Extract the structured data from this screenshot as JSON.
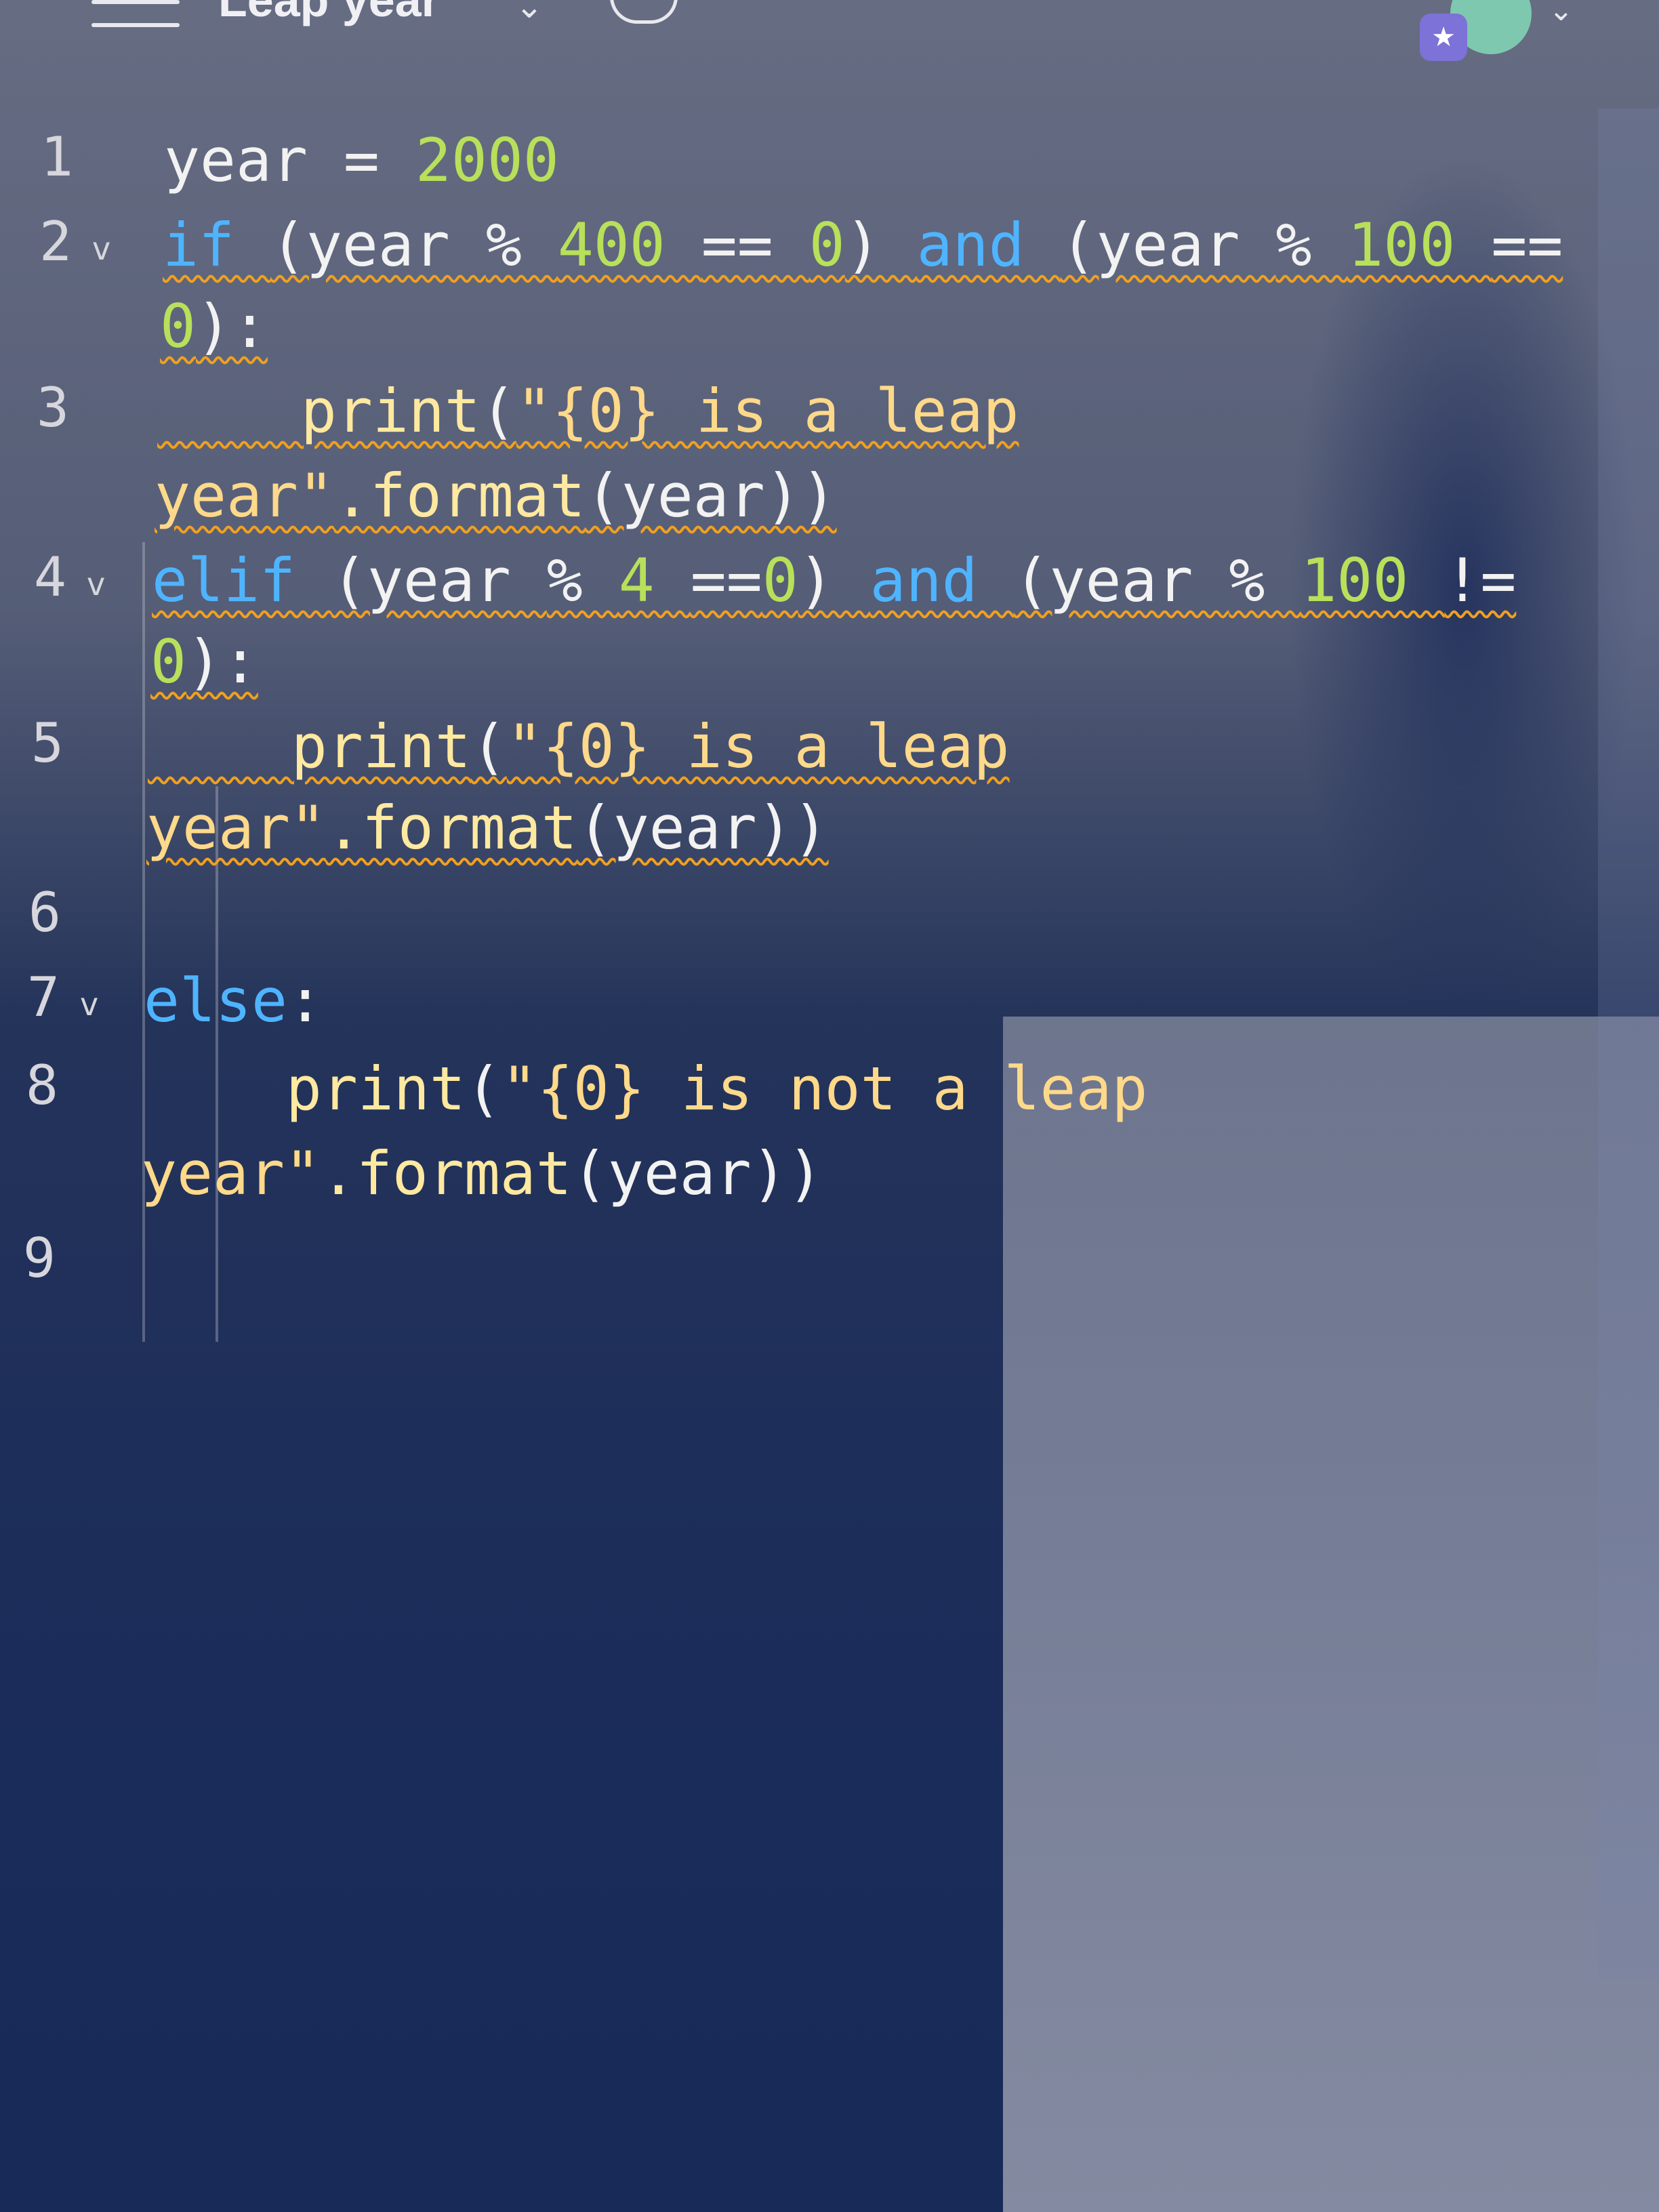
{
  "header": {
    "title": "Leap year",
    "menu_icon": "hamburger-menu-icon",
    "title_dropdown_icon": "chevron-down-icon",
    "cloud_icon": "cloud-sync-icon",
    "account_icon": "avatar",
    "account_dropdown_icon": "chevron-down-icon",
    "badge_icon": "star-icon",
    "badge_glyph": "★"
  },
  "editor": {
    "fold_glyph": "v",
    "lines": [
      {
        "number": "1",
        "segments": [
          {
            "cls": "var",
            "text": "year "
          },
          {
            "cls": "op",
            "text": "= "
          },
          {
            "cls": "num",
            "text": "2000"
          }
        ]
      },
      {
        "number": "2",
        "fold": true,
        "squiggle": true,
        "segments": [
          {
            "cls": "kw",
            "text": "if "
          },
          {
            "cls": "var",
            "text": "(year "
          },
          {
            "cls": "op",
            "text": "% "
          },
          {
            "cls": "num",
            "text": "400 "
          },
          {
            "cls": "op",
            "text": "== "
          },
          {
            "cls": "num",
            "text": "0"
          },
          {
            "cls": "var",
            "text": ") "
          },
          {
            "cls": "kw",
            "text": "and "
          },
          {
            "cls": "var",
            "text": "(year "
          },
          {
            "cls": "op",
            "text": "% "
          },
          {
            "cls": "num",
            "text": "100 "
          },
          {
            "cls": "op",
            "text": "=="
          }
        ]
      },
      {
        "number": "",
        "squiggle": true,
        "segments": [
          {
            "cls": "num",
            "text": "0"
          },
          {
            "cls": "var",
            "text": "):"
          }
        ]
      },
      {
        "number": "3",
        "squiggle": true,
        "segments": [
          {
            "cls": "fn",
            "text": "    print"
          },
          {
            "cls": "var",
            "text": "("
          },
          {
            "cls": "str",
            "text": "\"{0} is a leap"
          }
        ]
      },
      {
        "number": "",
        "squiggle": true,
        "segments": [
          {
            "cls": "str",
            "text": "year\""
          },
          {
            "cls": "fn",
            "text": ".format"
          },
          {
            "cls": "var",
            "text": "(year))"
          }
        ]
      },
      {
        "number": "4",
        "fold": true,
        "squiggle": true,
        "segments": [
          {
            "cls": "kw",
            "text": "elif "
          },
          {
            "cls": "var",
            "text": "(year "
          },
          {
            "cls": "op",
            "text": "% "
          },
          {
            "cls": "num",
            "text": "4 "
          },
          {
            "cls": "op",
            "text": "=="
          },
          {
            "cls": "num",
            "text": "0"
          },
          {
            "cls": "var",
            "text": ") "
          },
          {
            "cls": "kw",
            "text": "and "
          },
          {
            "cls": "var",
            "text": "(year "
          },
          {
            "cls": "op",
            "text": "% "
          },
          {
            "cls": "num",
            "text": "100 "
          },
          {
            "cls": "op",
            "text": "!="
          }
        ]
      },
      {
        "number": "",
        "squiggle": true,
        "segments": [
          {
            "cls": "num",
            "text": "0"
          },
          {
            "cls": "var",
            "text": "):"
          }
        ]
      },
      {
        "number": "5",
        "squiggle": true,
        "segments": [
          {
            "cls": "fn",
            "text": "    print"
          },
          {
            "cls": "var",
            "text": "("
          },
          {
            "cls": "str",
            "text": "\"{0} is a leap"
          }
        ]
      },
      {
        "number": "",
        "squiggle": true,
        "segments": [
          {
            "cls": "str",
            "text": "year\""
          },
          {
            "cls": "fn",
            "text": ".format"
          },
          {
            "cls": "var",
            "text": "(year))"
          }
        ]
      },
      {
        "number": "6",
        "segments": []
      },
      {
        "number": "7",
        "fold": true,
        "segments": [
          {
            "cls": "kw",
            "text": "else"
          },
          {
            "cls": "var",
            "text": ":"
          }
        ]
      },
      {
        "number": "8",
        "segments": [
          {
            "cls": "fn",
            "text": "    print"
          },
          {
            "cls": "var",
            "text": "("
          },
          {
            "cls": "str",
            "text": "\"{0} is not a leap"
          }
        ]
      },
      {
        "number": "",
        "segments": [
          {
            "cls": "str",
            "text": "year\""
          },
          {
            "cls": "fn",
            "text": ".format"
          },
          {
            "cls": "var",
            "text": "(year))"
          }
        ]
      },
      {
        "number": "9",
        "segments": []
      }
    ]
  },
  "colors": {
    "keyword": "#4fb4ff",
    "number": "#b8e05a",
    "string": "#ffd98a",
    "warning_squiggle": "#f0a020"
  }
}
